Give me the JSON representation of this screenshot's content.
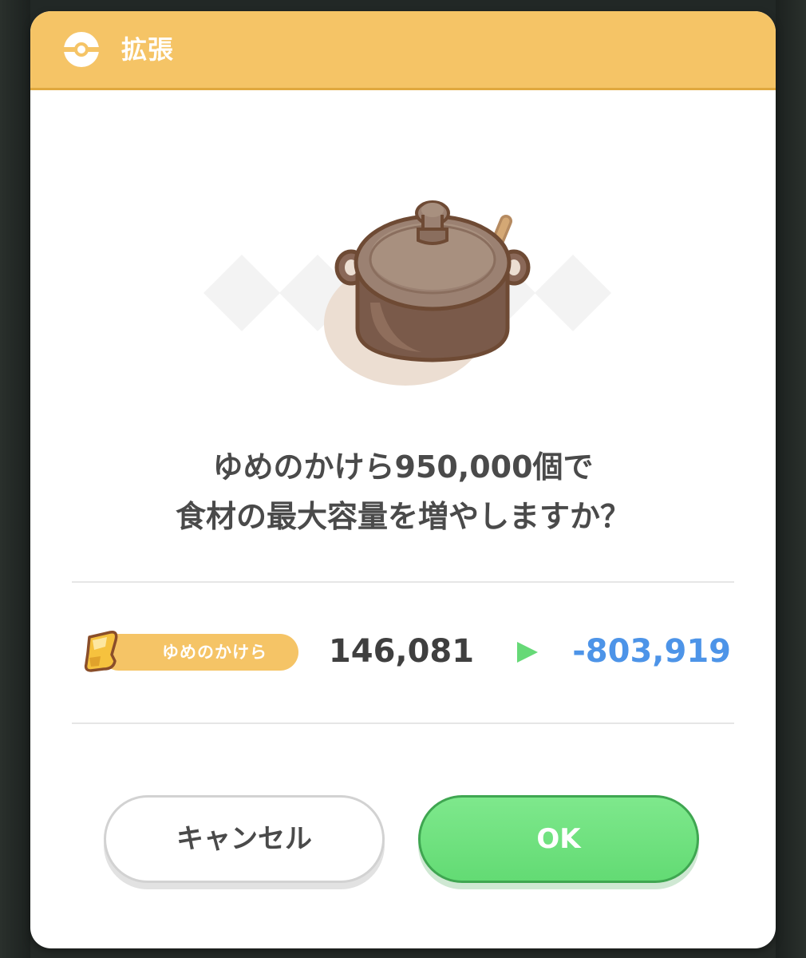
{
  "dialog": {
    "title": "拡張",
    "message_line1": "ゆめのかけら950,000個で",
    "message_line2": "食材の最大容量を増やしますか？",
    "header_icon": "pokeball-icon",
    "illustration": "cooking-pot-icon"
  },
  "currency": {
    "label": "ゆめのかけら",
    "icon": "dream-shard-icon",
    "current": "146,081",
    "arrow_icon": "play-arrow-icon",
    "result": "-803,919",
    "result_color": "#4d94e8"
  },
  "buttons": {
    "cancel_label": "キャンセル",
    "ok_label": "OK",
    "ok_color": "#68dd78"
  },
  "colors": {
    "header": "#f5c466",
    "badge": "#f5c466",
    "text": "#4a4a4a"
  }
}
